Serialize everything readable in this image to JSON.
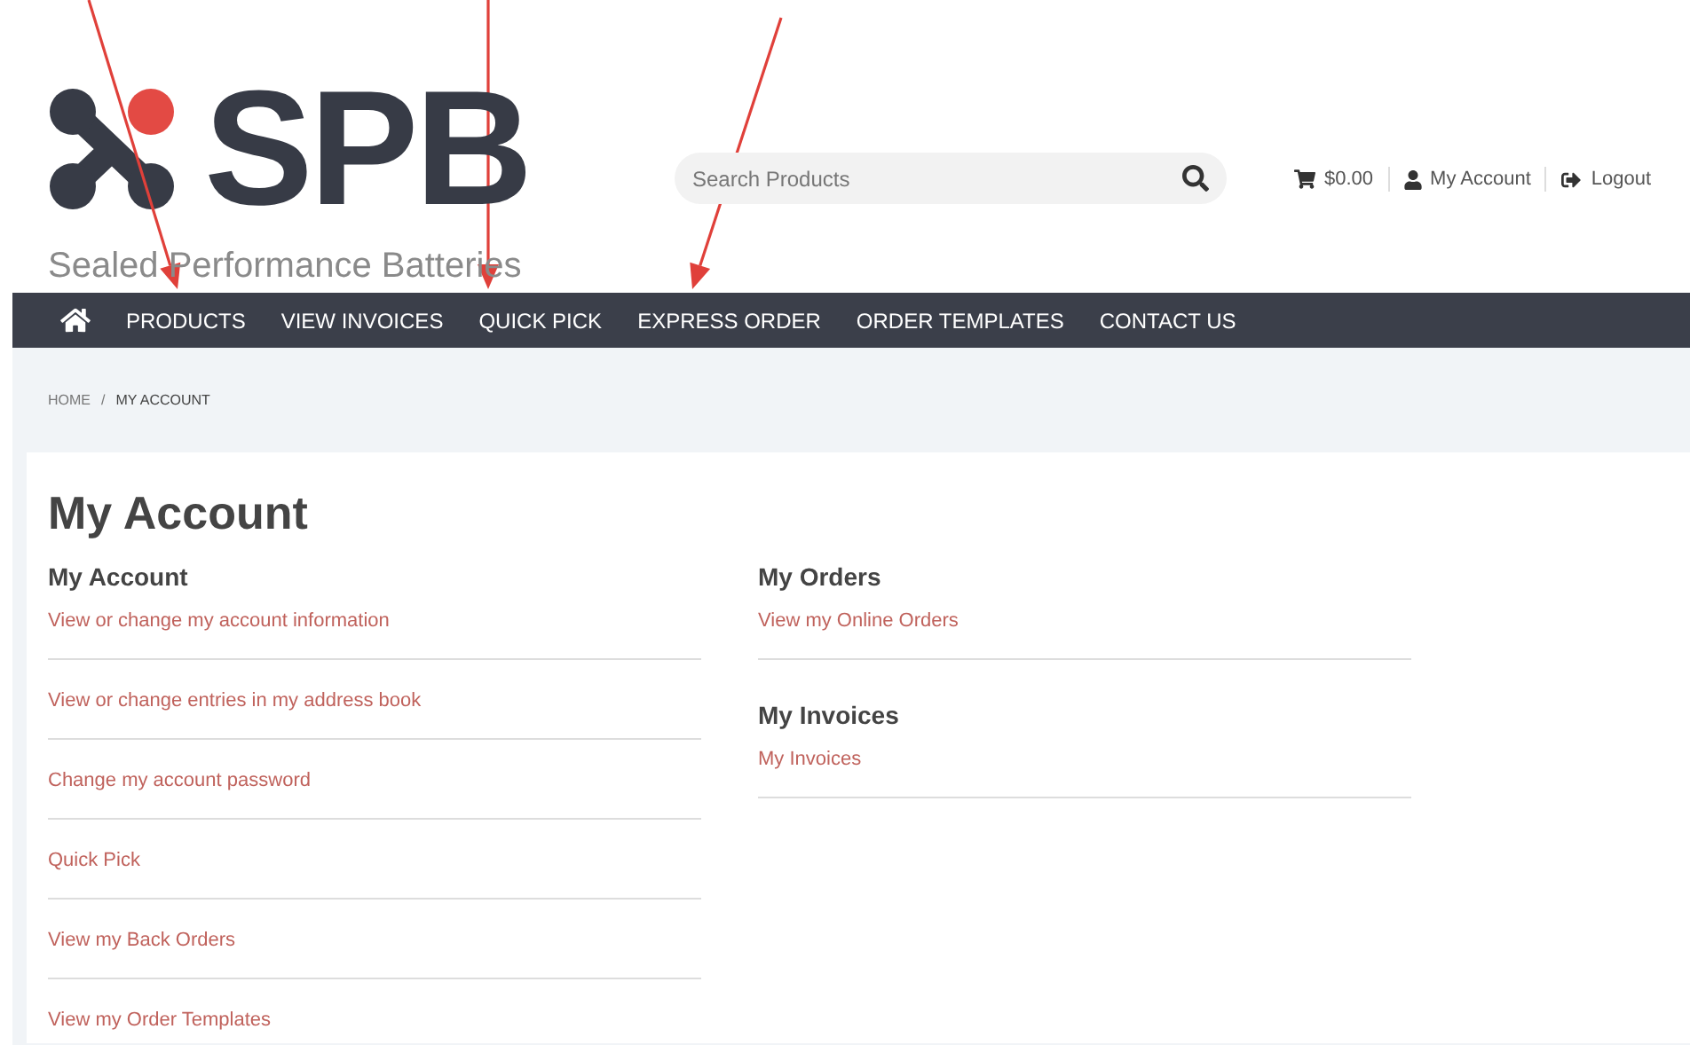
{
  "logo": {
    "letters": "SPB",
    "tagline": "Sealed Performance Batteries"
  },
  "search": {
    "placeholder": "Search Products"
  },
  "header_links": [
    {
      "kind": "cart",
      "label": "$0.00"
    },
    {
      "kind": "account",
      "label": "My Account"
    },
    {
      "kind": "logout",
      "label": "Logout"
    }
  ],
  "nav": [
    "PRODUCTS",
    "VIEW INVOICES",
    "QUICK PICK",
    "EXPRESS ORDER",
    "ORDER TEMPLATES",
    "CONTACT US"
  ],
  "breadcrumb": [
    "HOME",
    "MY ACCOUNT"
  ],
  "breadcrumb_separator": "/",
  "page_title": "My Account",
  "columns": [
    [
      {
        "title": "My Account",
        "links": [
          "View or change my account information",
          "View or change entries in my address book",
          "Change my account password",
          "Quick Pick",
          "View my Back Orders",
          "View my Order Templates"
        ]
      }
    ],
    [
      {
        "title": "My Orders",
        "links": [
          "View my Online Orders"
        ]
      },
      {
        "title": "My Invoices",
        "links": [
          "My Invoices"
        ]
      }
    ]
  ]
}
